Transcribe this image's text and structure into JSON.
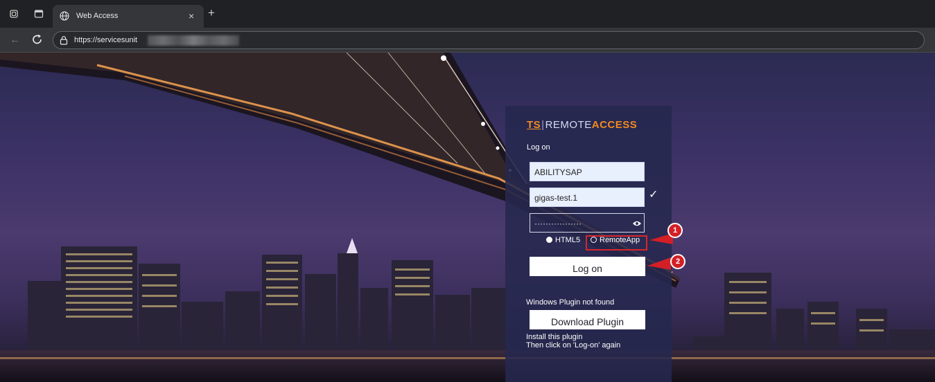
{
  "browser": {
    "tab_title": "Web Access",
    "tab_close": "×",
    "new_tab": "+",
    "url": "https://servicesunit"
  },
  "login": {
    "logo": {
      "ts": "TS",
      "separator": "|",
      "remote": "REMOTE",
      "access": "ACCESS"
    },
    "heading": "Log on",
    "server_value": "ABILITYSAP",
    "username_value": "gigas-test.1",
    "password_mask": "·················",
    "username_check": "✓",
    "radio_html5_label": "HTML5",
    "radio_remoteapp_label": "RemoteApp",
    "logon_button": "Log on",
    "plugin_status": "Windows Plugin not found",
    "download_button": "Download Plugin",
    "install_line1": "Install this plugin",
    "install_line2": "Then click on 'Log-on' again"
  },
  "callouts": {
    "step1": "1",
    "step2": "2",
    "color": "#d41f26"
  },
  "colors": {
    "brand_orange": "#f28a1f",
    "panel_bg": "#26284e",
    "highlight_red": "#d8262b"
  }
}
